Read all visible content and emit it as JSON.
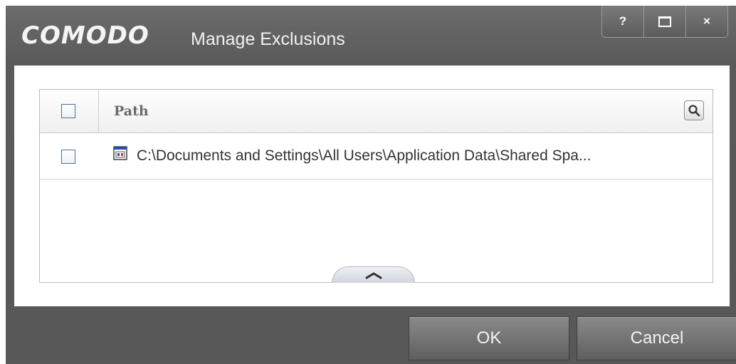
{
  "window": {
    "brand": "COMODO",
    "title": "Manage Exclusions",
    "controls": {
      "help_label": "?",
      "close_label": "×",
      "maximize_icon": "maximize-icon"
    }
  },
  "table": {
    "header": {
      "path_label": "Path",
      "search_icon": "search-icon"
    },
    "rows": [
      {
        "path": "C:\\Documents and Settings\\All Users\\Application Data\\Shared Spa...",
        "icon": "executable-file-icon",
        "checked": false
      }
    ],
    "collapse_icon": "chevron-up-icon"
  },
  "buttons": {
    "ok_label": "OK",
    "cancel_label": "Cancel"
  },
  "colors": {
    "window_bg": "#5f5f5f",
    "panel_bg": "#ffffff",
    "checkbox_border": "#4f6f93",
    "header_text": "#6b6b6b"
  }
}
